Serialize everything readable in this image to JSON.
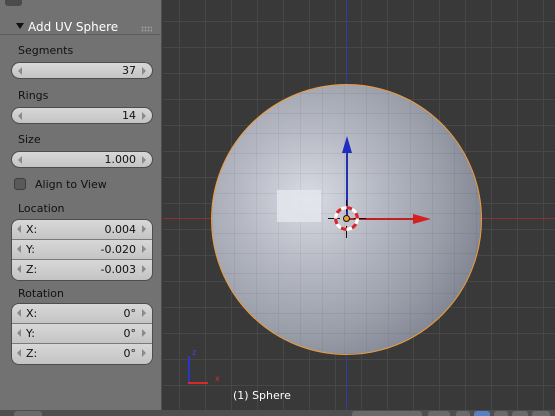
{
  "operator_panel": {
    "title": "Add UV Sphere",
    "segments": {
      "label": "Segments",
      "value": "37"
    },
    "rings": {
      "label": "Rings",
      "value": "14"
    },
    "size": {
      "label": "Size",
      "value": "1.000"
    },
    "align_to_view": {
      "label": "Align to View",
      "checked": false
    },
    "location": {
      "label": "Location",
      "x": {
        "axis": "X:",
        "value": "0.004"
      },
      "y": {
        "axis": "Y:",
        "value": "-0.020"
      },
      "z": {
        "axis": "Z:",
        "value": "-0.003"
      }
    },
    "rotation": {
      "label": "Rotation",
      "x": {
        "axis": "X:",
        "value": "0°"
      },
      "y": {
        "axis": "Y:",
        "value": "0°"
      },
      "z": {
        "axis": "Z:",
        "value": "0°"
      }
    }
  },
  "viewport": {
    "object_label": "(1) Sphere",
    "axis_widget": {
      "z_label": "z",
      "x_label": "x"
    }
  },
  "colors": {
    "selection_outline": "#ef9a38",
    "x_axis": "#d42020",
    "y_axis": "#1f2cc0",
    "panel_bg": "#727272",
    "viewport_bg": "#393939"
  },
  "icons": [
    "collapse-triangle-icon",
    "grip-icon",
    "checkbox-icon",
    "3d-cursor-icon",
    "transform-manipulator-icon",
    "axis-orientation-icon"
  ]
}
